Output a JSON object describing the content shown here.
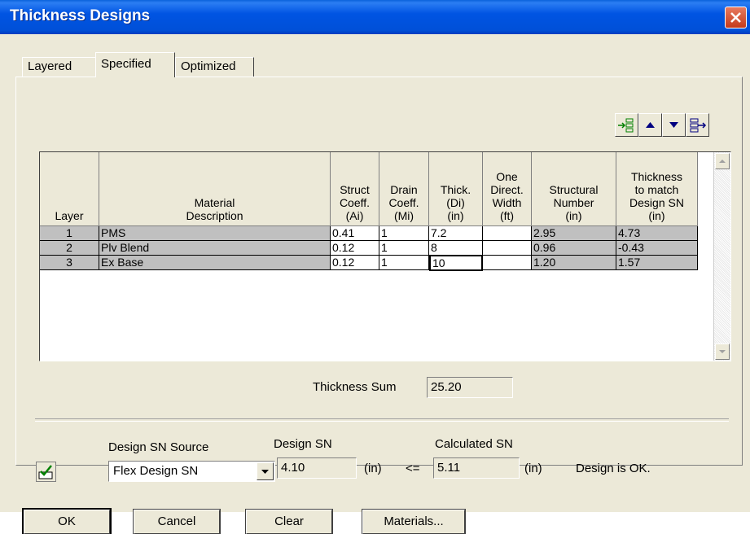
{
  "window": {
    "title": "Thickness Designs"
  },
  "tabs": [
    {
      "label": "Layered"
    },
    {
      "label": "Specified"
    },
    {
      "label": "Optimized"
    }
  ],
  "toolbar": {
    "icons": [
      "insert-row-icon",
      "move-up-icon",
      "move-down-icon",
      "append-row-icon"
    ]
  },
  "table": {
    "headers": [
      "Layer",
      "Material\nDescription",
      "Struct\nCoeff.\n(Ai)",
      "Drain\nCoeff.\n(Mi)",
      "Thick.\n(Di)\n(in)",
      "One\nDirect.\nWidth\n(ft)",
      "Structural\nNumber\n(in)",
      "Thickness\nto match\nDesign SN\n(in)"
    ],
    "rows": [
      {
        "layer": "1",
        "material": "PMS",
        "struct": "0.41",
        "drain": "1",
        "thick": "7.2",
        "width": "",
        "sn": "2.95",
        "match": "4.73"
      },
      {
        "layer": "2",
        "material": "Plv Blend",
        "struct": "0.12",
        "drain": "1",
        "thick": "8",
        "width": "",
        "sn": "0.96",
        "match": "-0.43"
      },
      {
        "layer": "3",
        "material": "Ex Base",
        "struct": "0.12",
        "drain": "1",
        "thick": "10",
        "width": "",
        "sn": "1.20",
        "match": "1.57"
      }
    ]
  },
  "thickness_sum": {
    "label": "Thickness Sum",
    "value": "25.20"
  },
  "design": {
    "source_label": "Design SN Source",
    "source_value": "Flex Design SN",
    "design_sn_label": "Design SN",
    "design_sn_value": "4.10",
    "unit1": "(in)",
    "comparator": "<=",
    "calc_sn_label": "Calculated SN",
    "calc_sn_value": "5.11",
    "unit2": "(in)",
    "status": "Design is OK."
  },
  "buttons": {
    "ok": "OK",
    "cancel": "Cancel",
    "clear": "Clear",
    "materials": "Materials..."
  },
  "colors": {
    "title_bar": "#0054e3",
    "dialog_bg": "#ece9d8",
    "row_gray": "#c0c0c0",
    "close": "#d9462a"
  }
}
